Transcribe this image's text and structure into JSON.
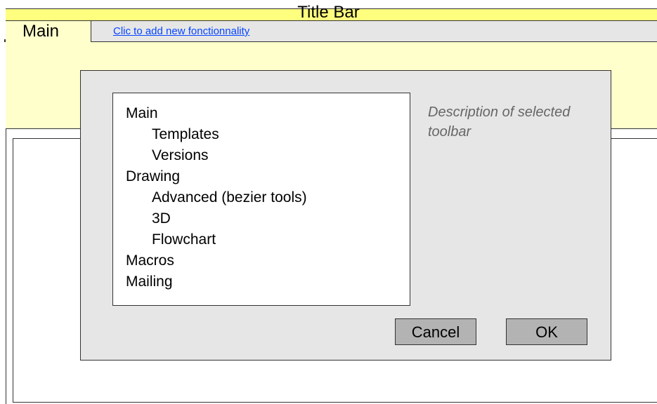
{
  "title_bar": {
    "title": "Title Bar"
  },
  "tabs": {
    "active_tab": "Main",
    "add_link": "Clic to add new fonctionnality"
  },
  "dialog": {
    "tree": [
      {
        "label": "Main",
        "level": 0
      },
      {
        "label": "Templates",
        "level": 1
      },
      {
        "label": "Versions",
        "level": 1
      },
      {
        "label": "Drawing",
        "level": 0
      },
      {
        "label": "Advanced (bezier tools)",
        "level": 1
      },
      {
        "label": "3D",
        "level": 1
      },
      {
        "label": "Flowchart",
        "level": 1
      },
      {
        "label": "Macros",
        "level": 0
      },
      {
        "label": "Mailing",
        "level": 0
      }
    ],
    "description": "Description of selected toolbar",
    "cancel_label": "Cancel",
    "ok_label": "OK"
  },
  "colors": {
    "title_bar": "#ffff7f",
    "toolbar_area": "#ffffcc",
    "dialog_bg": "#e6e6e6",
    "button_bg": "#b3b3b3",
    "link": "#0645ff",
    "description_text": "#666666"
  }
}
